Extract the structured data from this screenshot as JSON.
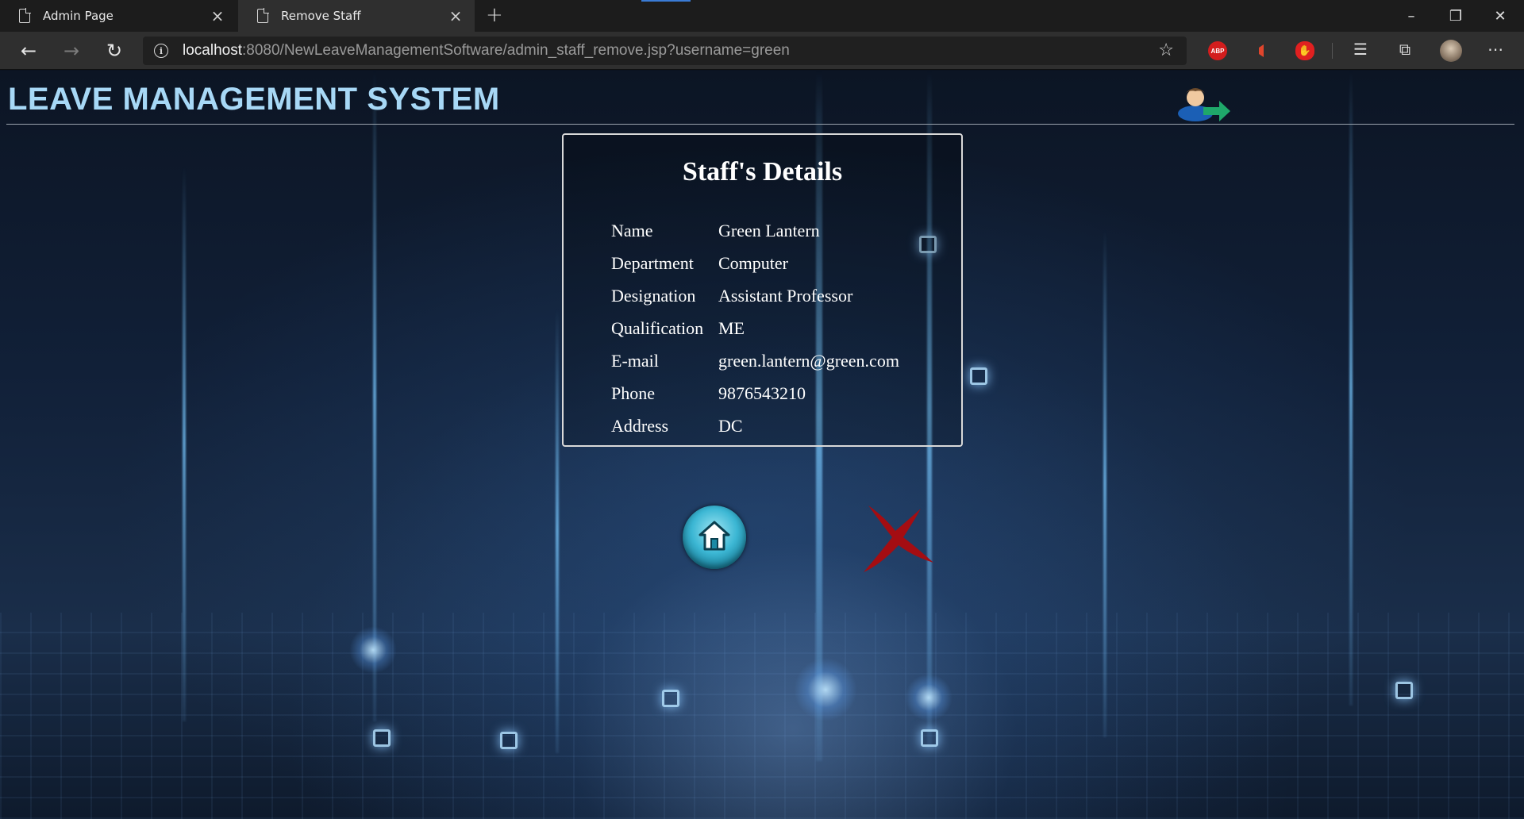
{
  "browser": {
    "tabs": [
      {
        "title": "Admin Page",
        "active": false
      },
      {
        "title": "Remove Staff",
        "active": true
      }
    ],
    "url_host": "localhost",
    "url_rest": ":8080/NewLeaveManagementSoftware/admin_staff_remove.jsp?username=green",
    "extensions": [
      "adblock-plus-icon",
      "pdf-icon",
      "red-hand-icon"
    ],
    "toolbar_icons": [
      "favorites-icon",
      "collections-icon",
      "profile-avatar",
      "more-icon"
    ]
  },
  "header": {
    "title": "LEAVE MANAGEMENT SYSTEM",
    "logout_icon": "logout-icon"
  },
  "details": {
    "title": "Staff's Details",
    "rows": [
      {
        "label": "Name",
        "value": "Green Lantern"
      },
      {
        "label": "Department",
        "value": "Computer"
      },
      {
        "label": "Designation",
        "value": "Assistant Professor"
      },
      {
        "label": "Qualification",
        "value": "ME"
      },
      {
        "label": "E-mail",
        "value": "green.lantern@green.com"
      },
      {
        "label": "Phone",
        "value": "9876543210"
      },
      {
        "label": "Address",
        "value": "DC"
      }
    ]
  },
  "actions": {
    "home_icon": "home-icon",
    "remove_icon": "remove-x-icon"
  },
  "colors": {
    "title": "#a7d8f6",
    "remove_x": "#a40d12",
    "home": "#3cb7d4"
  }
}
